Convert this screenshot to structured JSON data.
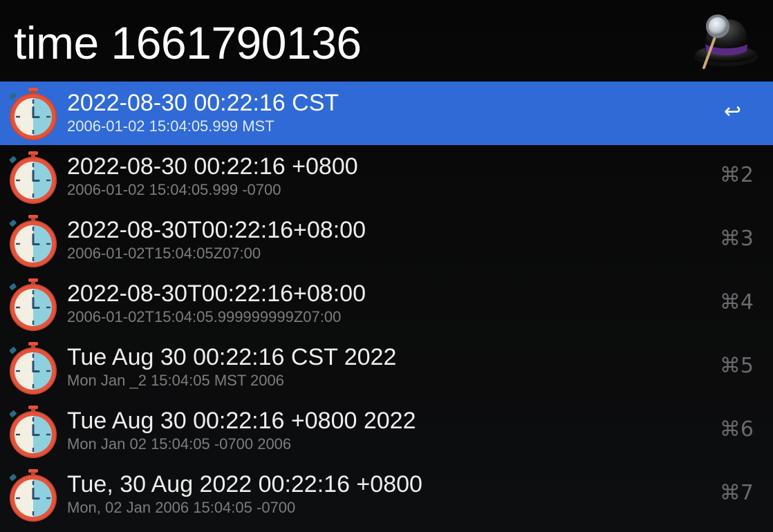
{
  "search": {
    "query": "time 1661790136"
  },
  "colors": {
    "selection": "#2f6ad6",
    "title": "#eeeeee",
    "subtitle": "#7d7d80",
    "stopwatch_ring": "#e5533b",
    "stopwatch_face_left": "#f3efe3",
    "stopwatch_face_right": "#8fd0de",
    "hand": "#2a4e73"
  },
  "results": [
    {
      "title": "2022-08-30 00:22:16 CST",
      "subtitle": "2006-01-02 15:04:05.999 MST",
      "shortcut": "↩",
      "icon": "stopwatch-icon",
      "selected": true
    },
    {
      "title": "2022-08-30 00:22:16 +0800",
      "subtitle": "2006-01-02 15:04:05.999 -0700",
      "shortcut": "⌘2",
      "icon": "stopwatch-icon",
      "selected": false
    },
    {
      "title": "2022-08-30T00:22:16+08:00",
      "subtitle": "2006-01-02T15:04:05Z07:00",
      "shortcut": "⌘3",
      "icon": "stopwatch-icon",
      "selected": false
    },
    {
      "title": "2022-08-30T00:22:16+08:00",
      "subtitle": "2006-01-02T15:04:05.999999999Z07:00",
      "shortcut": "⌘4",
      "icon": "stopwatch-icon",
      "selected": false
    },
    {
      "title": "Tue Aug 30 00:22:16 CST 2022",
      "subtitle": "Mon Jan _2 15:04:05 MST 2006",
      "shortcut": "⌘5",
      "icon": "stopwatch-icon",
      "selected": false
    },
    {
      "title": "Tue Aug 30 00:22:16 +0800 2022",
      "subtitle": "Mon Jan 02 15:04:05 -0700 2006",
      "shortcut": "⌘6",
      "icon": "stopwatch-icon",
      "selected": false
    },
    {
      "title": "Tue, 30 Aug 2022 00:22:16 +0800",
      "subtitle": "Mon, 02 Jan 2006 15:04:05 -0700",
      "shortcut": "⌘7",
      "icon": "stopwatch-icon",
      "selected": false
    }
  ]
}
